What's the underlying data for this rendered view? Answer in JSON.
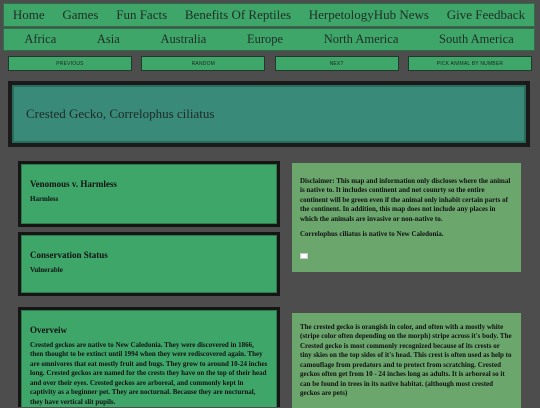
{
  "nav_top": [
    "Home",
    "Games",
    "Fun Facts",
    "Benefits Of Reptiles",
    "HerpetologyHub News",
    "Give Feedback"
  ],
  "nav_continents": [
    "Africa",
    "Asia",
    "Australia",
    "Europe",
    "North America",
    "South America"
  ],
  "buttons": {
    "previous": "PREVIOUS",
    "random": "RANDOM",
    "next": "NEXT",
    "pick": "PICK ANIMAL BY NUMBER"
  },
  "title": "Crested Gecko, Correlophus ciliatus",
  "venomous": {
    "heading": "Venomous v. Harmless",
    "value": "Harmless"
  },
  "conservation": {
    "heading": "Conservation Status",
    "value": "Vulnerable"
  },
  "overview": {
    "heading": "Overveiw",
    "text": "Crested geckos are native to New Caledonia. They were discovered in 1866, then thought to be extinct until 1994 when they were rediscovered again. They are omnivores that eat mostly fruit and bugs. They grow to around 10-24 inches long. Crested geckos are named for the crests they have on the top of their head and over their eyes. Crested geckos are arboreal, and commonly kept in captivity as a beginner pet. They are nocturnal. Because they are nocturnal, they have vertical slit pupils."
  },
  "disclaimer": {
    "text": "Disclaimer: This map and information only discloses where the animal is native to. It includes continent and not counrty so the entire continent will be green even if the animal only inhabit certain parts of the continent. In addition, this map does not include any places in which the animals are invasive or non-native to.",
    "native": "Correlophus ciliatus is native to New Caledonia."
  },
  "description": "The crested gecko is orangish in color, and often with a mostly white (stripe color often depending on the morph) stripe across it's body. The Crested gecko is most commonly recognized because of its crests or tiny skies on the top sides of it's head. This crest is often used as help to camouflage from predators and to protect from scratching. Crested geckos often get from 10 - 24 inches long as adults. It is arboreal so it can be found in trees in its native habitat. (although most crested geckos are pets)"
}
